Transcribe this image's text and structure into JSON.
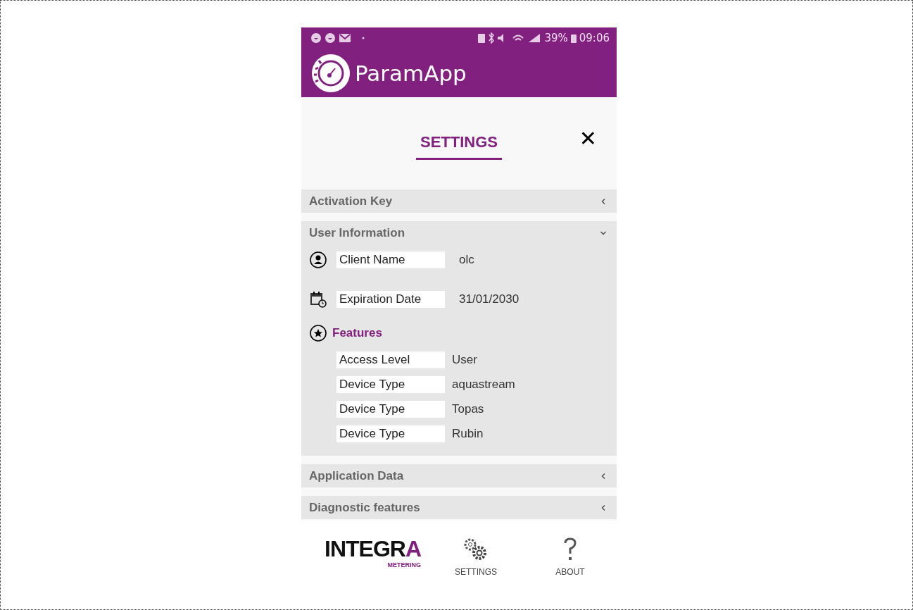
{
  "status_bar": {
    "battery": "39%",
    "time": "09:06"
  },
  "app_bar": {
    "title": "ParamApp"
  },
  "header": {
    "title": "SETTINGS",
    "close": "✕"
  },
  "sections": [
    {
      "title": "Activation Key",
      "expanded": false
    },
    {
      "title": "User Information",
      "expanded": true,
      "fields": [
        {
          "label": "Client Name",
          "value": "olc"
        },
        {
          "label": "Expiration Date",
          "value": "31/01/2030"
        }
      ],
      "features": {
        "title": "Features",
        "items": [
          {
            "label": "Access Level",
            "value": "User"
          },
          {
            "label": "Device Type",
            "value": "aquastream"
          },
          {
            "label": "Device Type",
            "value": "Topas"
          },
          {
            "label": "Device Type",
            "value": "Rubin"
          }
        ]
      }
    },
    {
      "title": "Application Data",
      "expanded": false
    },
    {
      "title": "Diagnostic features",
      "expanded": false
    }
  ],
  "footer": {
    "logo": {
      "text": "INTEGRA",
      "sub": "METERING"
    },
    "nav": [
      {
        "label": "SETTINGS"
      },
      {
        "label": "ABOUT"
      }
    ]
  }
}
